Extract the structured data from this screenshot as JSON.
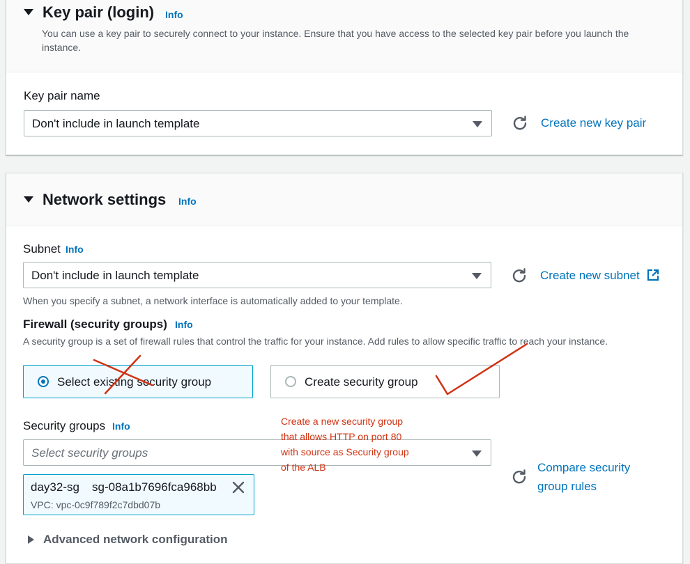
{
  "key_pair": {
    "title": "Key pair (login)",
    "info": "Info",
    "description": "You can use a key pair to securely connect to your instance. Ensure that you have access to the selected key pair before you launch the instance.",
    "field_label": "Key pair name",
    "selected": "Don't include in launch template",
    "create_link": "Create new key pair"
  },
  "network": {
    "title": "Network settings",
    "info": "Info",
    "subnet": {
      "label": "Subnet",
      "info": "Info",
      "selected": "Don't include in launch template",
      "create_link": "Create new subnet",
      "hint": "When you specify a subnet, a network interface is automatically added to your template."
    },
    "firewall": {
      "label": "Firewall (security groups)",
      "info": "Info",
      "description": "A security group is a set of firewall rules that control the traffic for your instance. Add rules to allow specific traffic to reach your instance.",
      "options": [
        {
          "label": "Select existing security group",
          "selected": true
        },
        {
          "label": "Create security group",
          "selected": false
        }
      ]
    },
    "security_groups": {
      "label": "Security groups",
      "info": "Info",
      "placeholder": "Select security groups",
      "compare_link_line1": "Compare security",
      "compare_link_line2": "group rules",
      "token": {
        "name": "day32-sg",
        "id": "sg-08a1b7696fca968bb",
        "vpc": "VPC: vpc-0c9f789f2c7dbd07b"
      }
    },
    "advanced": "Advanced network configuration"
  },
  "annotation": {
    "text": "Create a new security group that allows HTTP on port 80 with source as Security group of the ALB",
    "color": "#d13212"
  },
  "colors": {
    "link": "#0073bb",
    "selected_border": "#00a1c9",
    "annotation_mark": "#d13212"
  },
  "icons": [
    "caret-down-icon",
    "refresh-icon",
    "external-link-icon",
    "close-icon",
    "caret-right-icon"
  ]
}
